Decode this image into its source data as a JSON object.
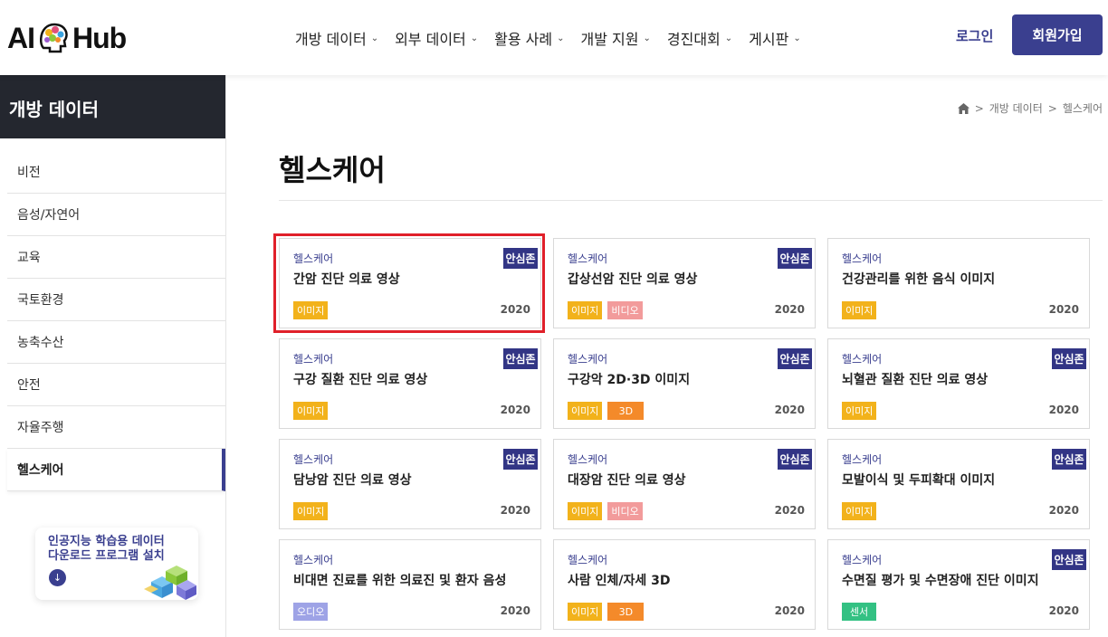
{
  "header": {
    "logo_left": "AI",
    "logo_right": "Hub",
    "nav": [
      {
        "label": "개방 데이터"
      },
      {
        "label": "외부 데이터"
      },
      {
        "label": "활용 사례"
      },
      {
        "label": "개발 지원"
      },
      {
        "label": "경진대회"
      },
      {
        "label": "게시판"
      }
    ],
    "login": "로그인",
    "signup": "회원가입"
  },
  "sidebar": {
    "title": "개방 데이터",
    "items": [
      {
        "label": "비전"
      },
      {
        "label": "음성/자연어"
      },
      {
        "label": "교육"
      },
      {
        "label": "국토환경"
      },
      {
        "label": "농축수산"
      },
      {
        "label": "안전"
      },
      {
        "label": "자율주행"
      },
      {
        "label": "헬스케어"
      }
    ],
    "active_index": 7,
    "promo": {
      "line1": "인공지능 학습용 데이터",
      "line2": "다운로드 프로그램 설치"
    }
  },
  "breadcrumb": [
    "개방 데이터",
    "헬스케어"
  ],
  "page_title": "헬스케어",
  "cards": [
    {
      "category": "헬스케어",
      "name": "간암 진단 의료 영상",
      "badge": "안심존",
      "tags": [
        {
          "label": "이미지",
          "kind": "img"
        }
      ],
      "year": "2020"
    },
    {
      "category": "헬스케어",
      "name": "갑상선암 진단 의료 영상",
      "badge": "안심존",
      "tags": [
        {
          "label": "이미지",
          "kind": "img"
        },
        {
          "label": "비디오",
          "kind": "vid"
        }
      ],
      "year": "2020"
    },
    {
      "category": "헬스케어",
      "name": "건강관리를 위한 음식 이미지",
      "badge": "",
      "tags": [
        {
          "label": "이미지",
          "kind": "img"
        }
      ],
      "year": "2020"
    },
    {
      "category": "헬스케어",
      "name": "구강 질환 진단 의료 영상",
      "badge": "안심존",
      "tags": [
        {
          "label": "이미지",
          "kind": "img"
        }
      ],
      "year": "2020"
    },
    {
      "category": "헬스케어",
      "name": "구강악 2D·3D 이미지",
      "badge": "안심존",
      "tags": [
        {
          "label": "이미지",
          "kind": "img"
        },
        {
          "label": "3D",
          "kind": "td"
        }
      ],
      "year": "2020"
    },
    {
      "category": "헬스케어",
      "name": "뇌혈관 질환 진단 의료 영상",
      "badge": "안심존",
      "tags": [
        {
          "label": "이미지",
          "kind": "img"
        }
      ],
      "year": "2020"
    },
    {
      "category": "헬스케어",
      "name": "담낭암 진단 의료 영상",
      "badge": "안심존",
      "tags": [
        {
          "label": "이미지",
          "kind": "img"
        }
      ],
      "year": "2020"
    },
    {
      "category": "헬스케어",
      "name": "대장암 진단 의료 영상",
      "badge": "안심존",
      "tags": [
        {
          "label": "이미지",
          "kind": "img"
        },
        {
          "label": "비디오",
          "kind": "vid"
        }
      ],
      "year": "2020"
    },
    {
      "category": "헬스케어",
      "name": "모발이식 및 두피확대 이미지",
      "badge": "안심존",
      "tags": [
        {
          "label": "이미지",
          "kind": "img"
        }
      ],
      "year": "2020"
    },
    {
      "category": "헬스케어",
      "name": "비대면 진료를 위한 의료진 및 환자 음성",
      "badge": "",
      "tags": [
        {
          "label": "오디오",
          "kind": "aud"
        }
      ],
      "year": "2020"
    },
    {
      "category": "헬스케어",
      "name": "사람 인체/자세 3D",
      "badge": "",
      "tags": [
        {
          "label": "이미지",
          "kind": "img"
        },
        {
          "label": "3D",
          "kind": "td"
        }
      ],
      "year": "2020"
    },
    {
      "category": "헬스케어",
      "name": "수면질 평가 및 수면장애 진단 이미지",
      "badge": "안심존",
      "tags": [
        {
          "label": "센서",
          "kind": "sen"
        }
      ],
      "year": "2020"
    }
  ],
  "colors": {
    "brand": "#3a3f8f",
    "badge": "#323585",
    "highlight": "#e0202a"
  }
}
